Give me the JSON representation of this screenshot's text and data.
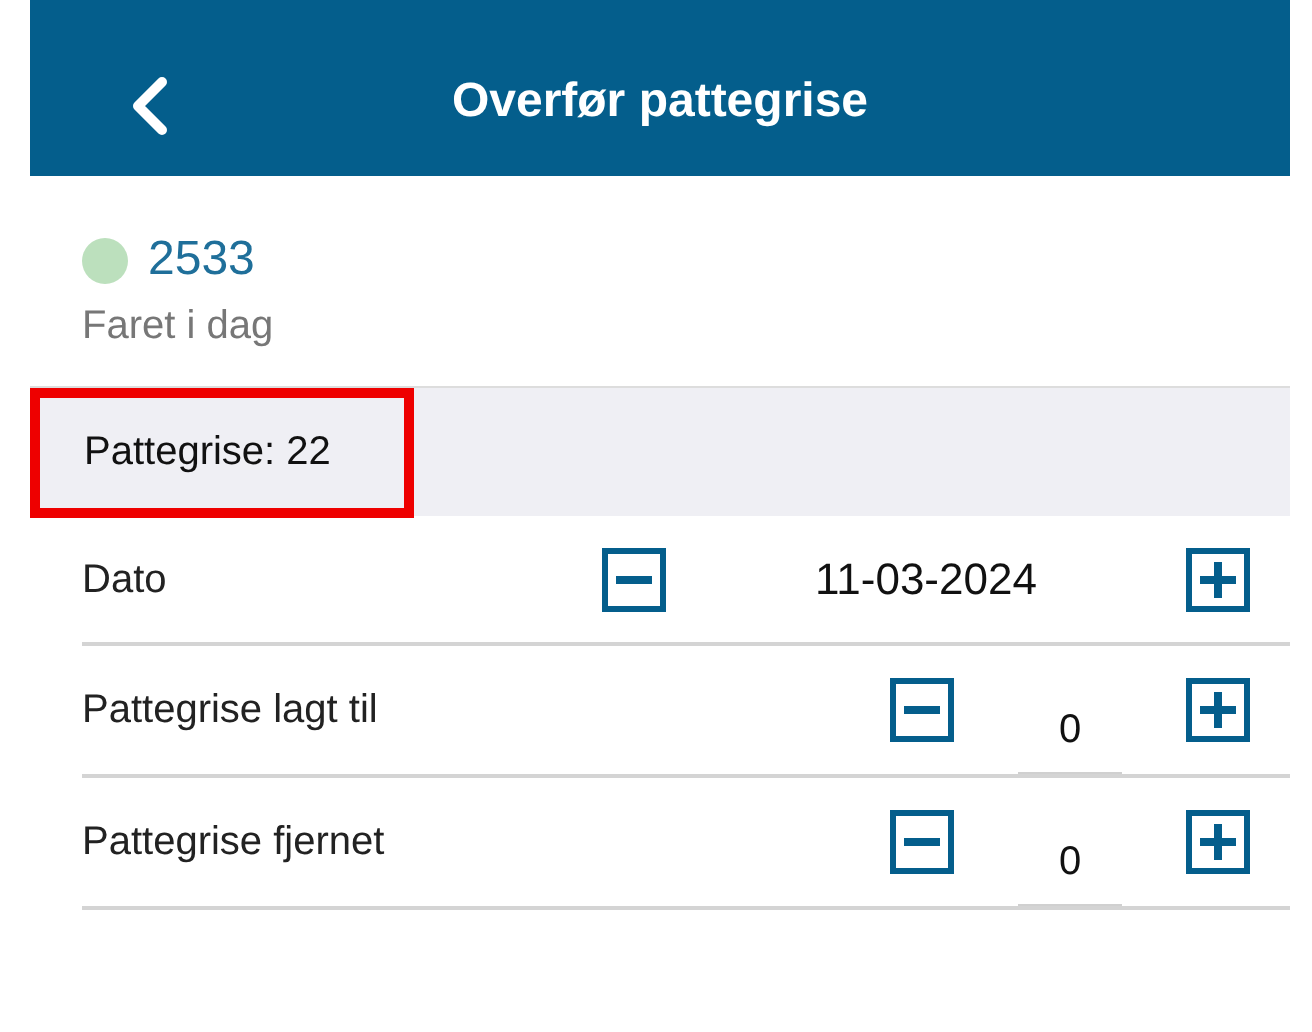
{
  "header": {
    "title": "Overfør pattegrise"
  },
  "sow": {
    "number": "2533",
    "status": "Faret i dag"
  },
  "summary": {
    "label": "Pattegrise: 22",
    "highlighted": true
  },
  "rows": [
    {
      "kind": "date",
      "label": "Dato",
      "value": "11-03-2024"
    },
    {
      "kind": "count",
      "label": "Pattegrise lagt til",
      "value": "0"
    },
    {
      "kind": "count",
      "label": "Pattegrise fjernet",
      "value": "0"
    }
  ]
}
